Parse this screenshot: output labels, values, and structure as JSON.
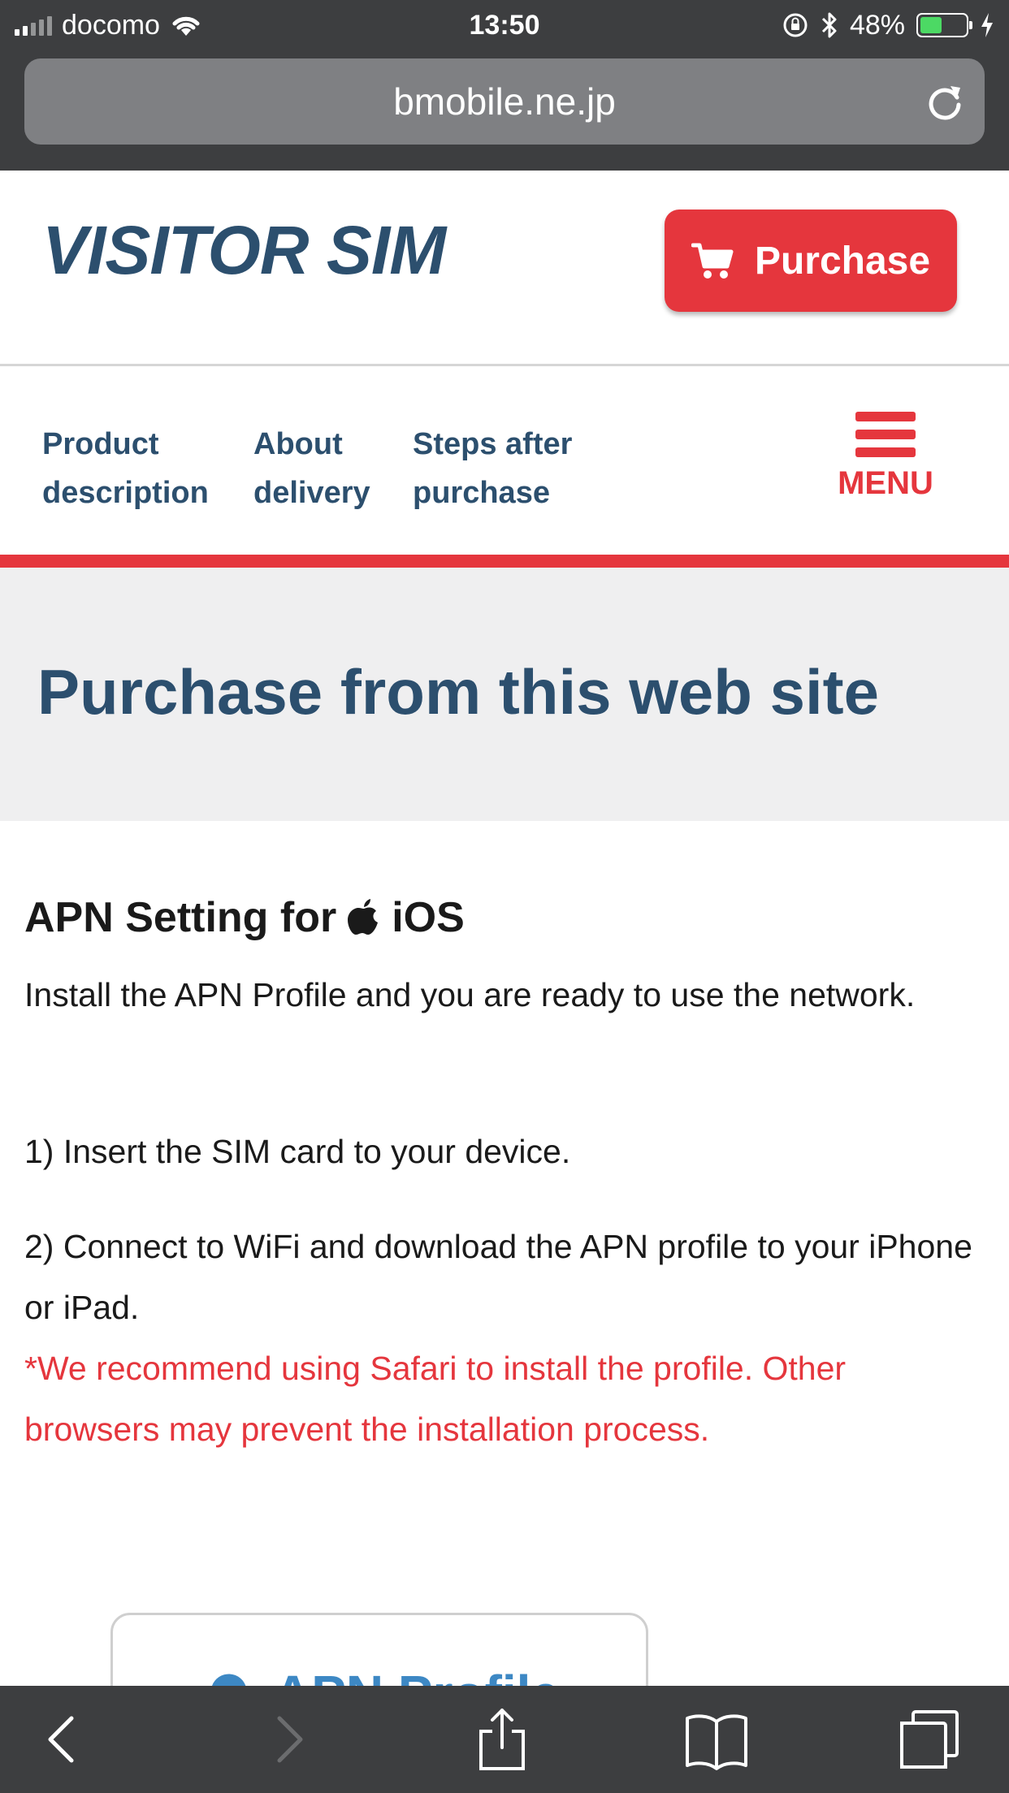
{
  "status_bar": {
    "carrier": "docomo",
    "time": "13:50",
    "battery_percent": "48%",
    "battery_level": 0.48,
    "icons": [
      "signal-icon",
      "wifi-icon",
      "orientation-lock-icon",
      "bluetooth-icon",
      "battery-icon",
      "charging-icon"
    ]
  },
  "url_bar": {
    "url": "bmobile.ne.jp",
    "reload_icon": "reload-icon"
  },
  "header": {
    "logo": "VISITOR SIM",
    "purchase_label": "Purchase",
    "purchase_icon": "cart-icon"
  },
  "nav": {
    "items": [
      {
        "line1": "Product",
        "line2": "description"
      },
      {
        "line1": "About",
        "line2": "delivery"
      },
      {
        "line1": "Steps after",
        "line2": "purchase"
      }
    ],
    "menu_label": "MENU"
  },
  "hero": {
    "title": "Purchase from this web site"
  },
  "content": {
    "heading_before": "APN Setting for",
    "heading_after": "iOS",
    "intro": "Install the APN Profile and you are ready to use the network.",
    "step1": "1) Insert the SIM card to your device.",
    "step2": "2) Connect to WiFi and download the APN profile to your iPhone or iPad.",
    "warning": "*We recommend using Safari to install the profile. Other browsers may prevent the installation process.",
    "apn_button": "APN Profile"
  },
  "toolbar": {
    "icons": [
      "back-icon",
      "forward-icon",
      "share-icon",
      "bookmarks-icon",
      "tabs-icon"
    ]
  },
  "colors": {
    "brand_red": "#e5363d",
    "brand_navy": "#2c4f6e",
    "link_blue": "#3d88c4",
    "chrome_dark": "#3d3e40"
  }
}
